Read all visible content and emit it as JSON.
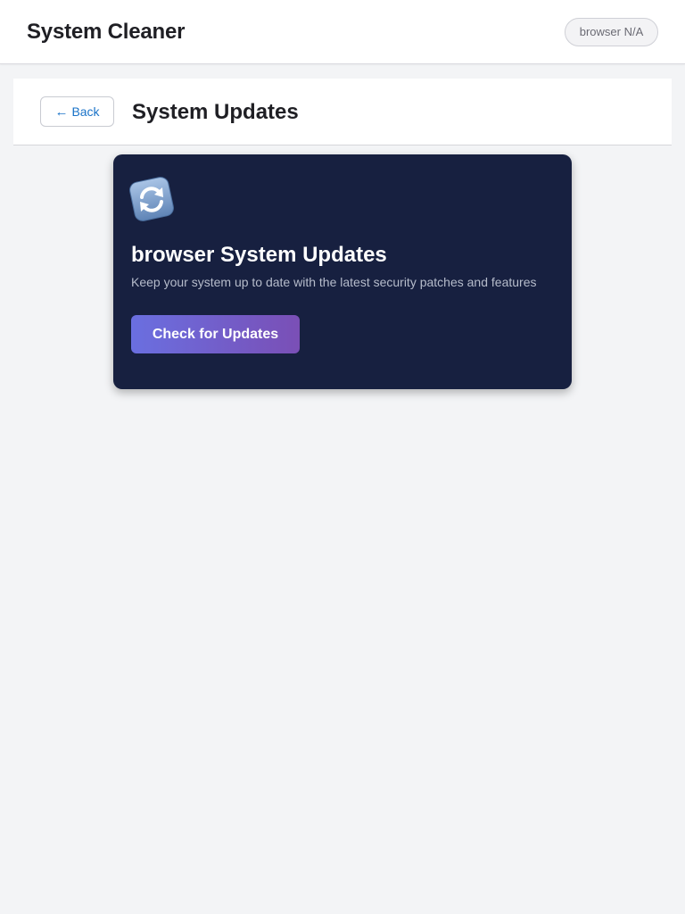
{
  "header": {
    "app_title": "System Cleaner",
    "browser_badge": "browser N/A"
  },
  "page_header": {
    "back_arrow": "←",
    "back_label": "Back",
    "title": "System Updates"
  },
  "update_card": {
    "icon": "refresh-icon",
    "title": "browser System Updates",
    "description": "Keep your system up to date with the latest security patches and features",
    "button_label": "Check for Updates"
  },
  "colors": {
    "card_background": "#172040",
    "button_gradient_start": "#6a6fe0",
    "button_gradient_end": "#7a4fb6",
    "link_blue": "#1a73c8",
    "page_background": "#f3f4f6"
  }
}
